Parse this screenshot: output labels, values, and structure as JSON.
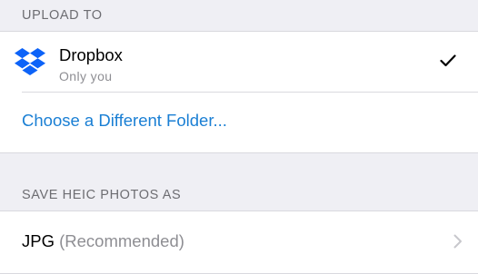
{
  "upload_section": {
    "header": "UPLOAD TO",
    "destination": {
      "title": "Dropbox",
      "subtitle": "Only you",
      "icon": "dropbox-logo",
      "selected_icon": "checkmark-icon"
    },
    "choose_folder_label": "Choose a Different Folder..."
  },
  "heic_section": {
    "header": "SAVE HEIC PHOTOS AS",
    "format_value": "JPG",
    "format_note": "(Recommended)",
    "disclosure_icon": "chevron-right-icon"
  },
  "colors": {
    "background": "#efeff4",
    "link": "#1a7fd4",
    "dropbox_blue": "#0d63f8",
    "secondary_text": "#8e8e93"
  }
}
